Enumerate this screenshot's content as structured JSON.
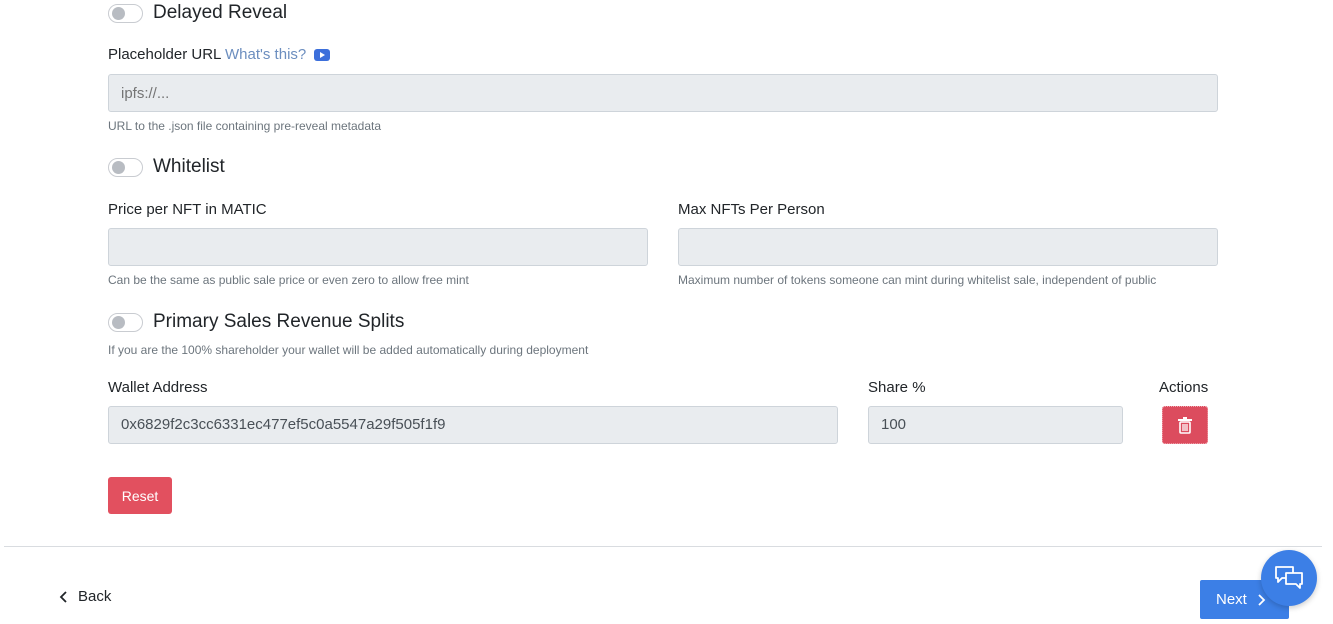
{
  "delayed_reveal": {
    "label": "Delayed Reveal",
    "enabled": false
  },
  "placeholder_url": {
    "label": "Placeholder URL",
    "link_text": "What's this?",
    "placeholder": "ipfs://...",
    "value": "",
    "help": "URL to the .json file containing pre-reveal metadata"
  },
  "whitelist": {
    "label": "Whitelist",
    "enabled": false,
    "price": {
      "label": "Price per NFT in MATIC",
      "value": "",
      "help": "Can be the same as public sale price or even zero to allow free mint"
    },
    "max": {
      "label": "Max NFTs Per Person",
      "value": "",
      "help": "Maximum number of tokens someone can mint during whitelist sale, independent of public"
    }
  },
  "revenue_splits": {
    "label": "Primary Sales Revenue Splits",
    "enabled": false,
    "help": "If you are the 100% shareholder your wallet will be added automatically during deployment",
    "columns": {
      "wallet": "Wallet Address",
      "share": "Share %",
      "actions": "Actions"
    },
    "rows": [
      {
        "wallet": "0x6829f2c3cc6331ec477ef5c0a5547a29f505f1f9",
        "share": "100"
      }
    ]
  },
  "buttons": {
    "reset": "Reset",
    "back": "Back",
    "next": "Next"
  },
  "colors": {
    "primary": "#3c7fe6",
    "danger": "#dc4c5e",
    "input_bg": "#e9ecef"
  },
  "icons": {
    "trash": "trash-icon",
    "chat": "chat-icon",
    "back": "chevron-left-icon",
    "next": "chevron-right-icon",
    "video": "youtube-icon"
  }
}
